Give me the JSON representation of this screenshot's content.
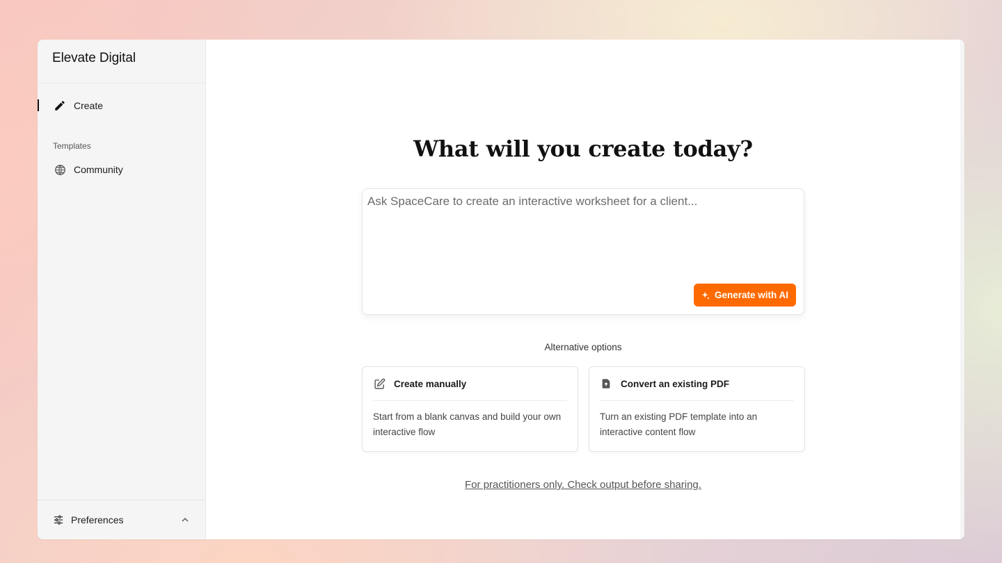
{
  "sidebar": {
    "brand": "Elevate Digital",
    "nav": {
      "create_label": "Create",
      "templates_section": "Templates",
      "community_label": "Community"
    },
    "preferences_label": "Preferences"
  },
  "main": {
    "headline": "What will you create today?",
    "prompt": {
      "placeholder": "Ask SpaceCare to create an interactive worksheet for a client...",
      "value": ""
    },
    "generate_button": "Generate with AI",
    "alternative_label": "Alternative options",
    "options": [
      {
        "title": "Create manually",
        "description": "Start from a blank canvas and build your own interactive flow",
        "icon": "edit-square-icon"
      },
      {
        "title": "Convert an existing PDF",
        "description": "Turn an existing PDF template into an interactive content flow",
        "icon": "file-upload-icon"
      }
    ],
    "disclaimer": "For practitioners only. Check output before sharing."
  },
  "colors": {
    "accent": "#ff6a00",
    "sidebar_bg": "#f5f5f5",
    "text_primary": "#111111"
  }
}
